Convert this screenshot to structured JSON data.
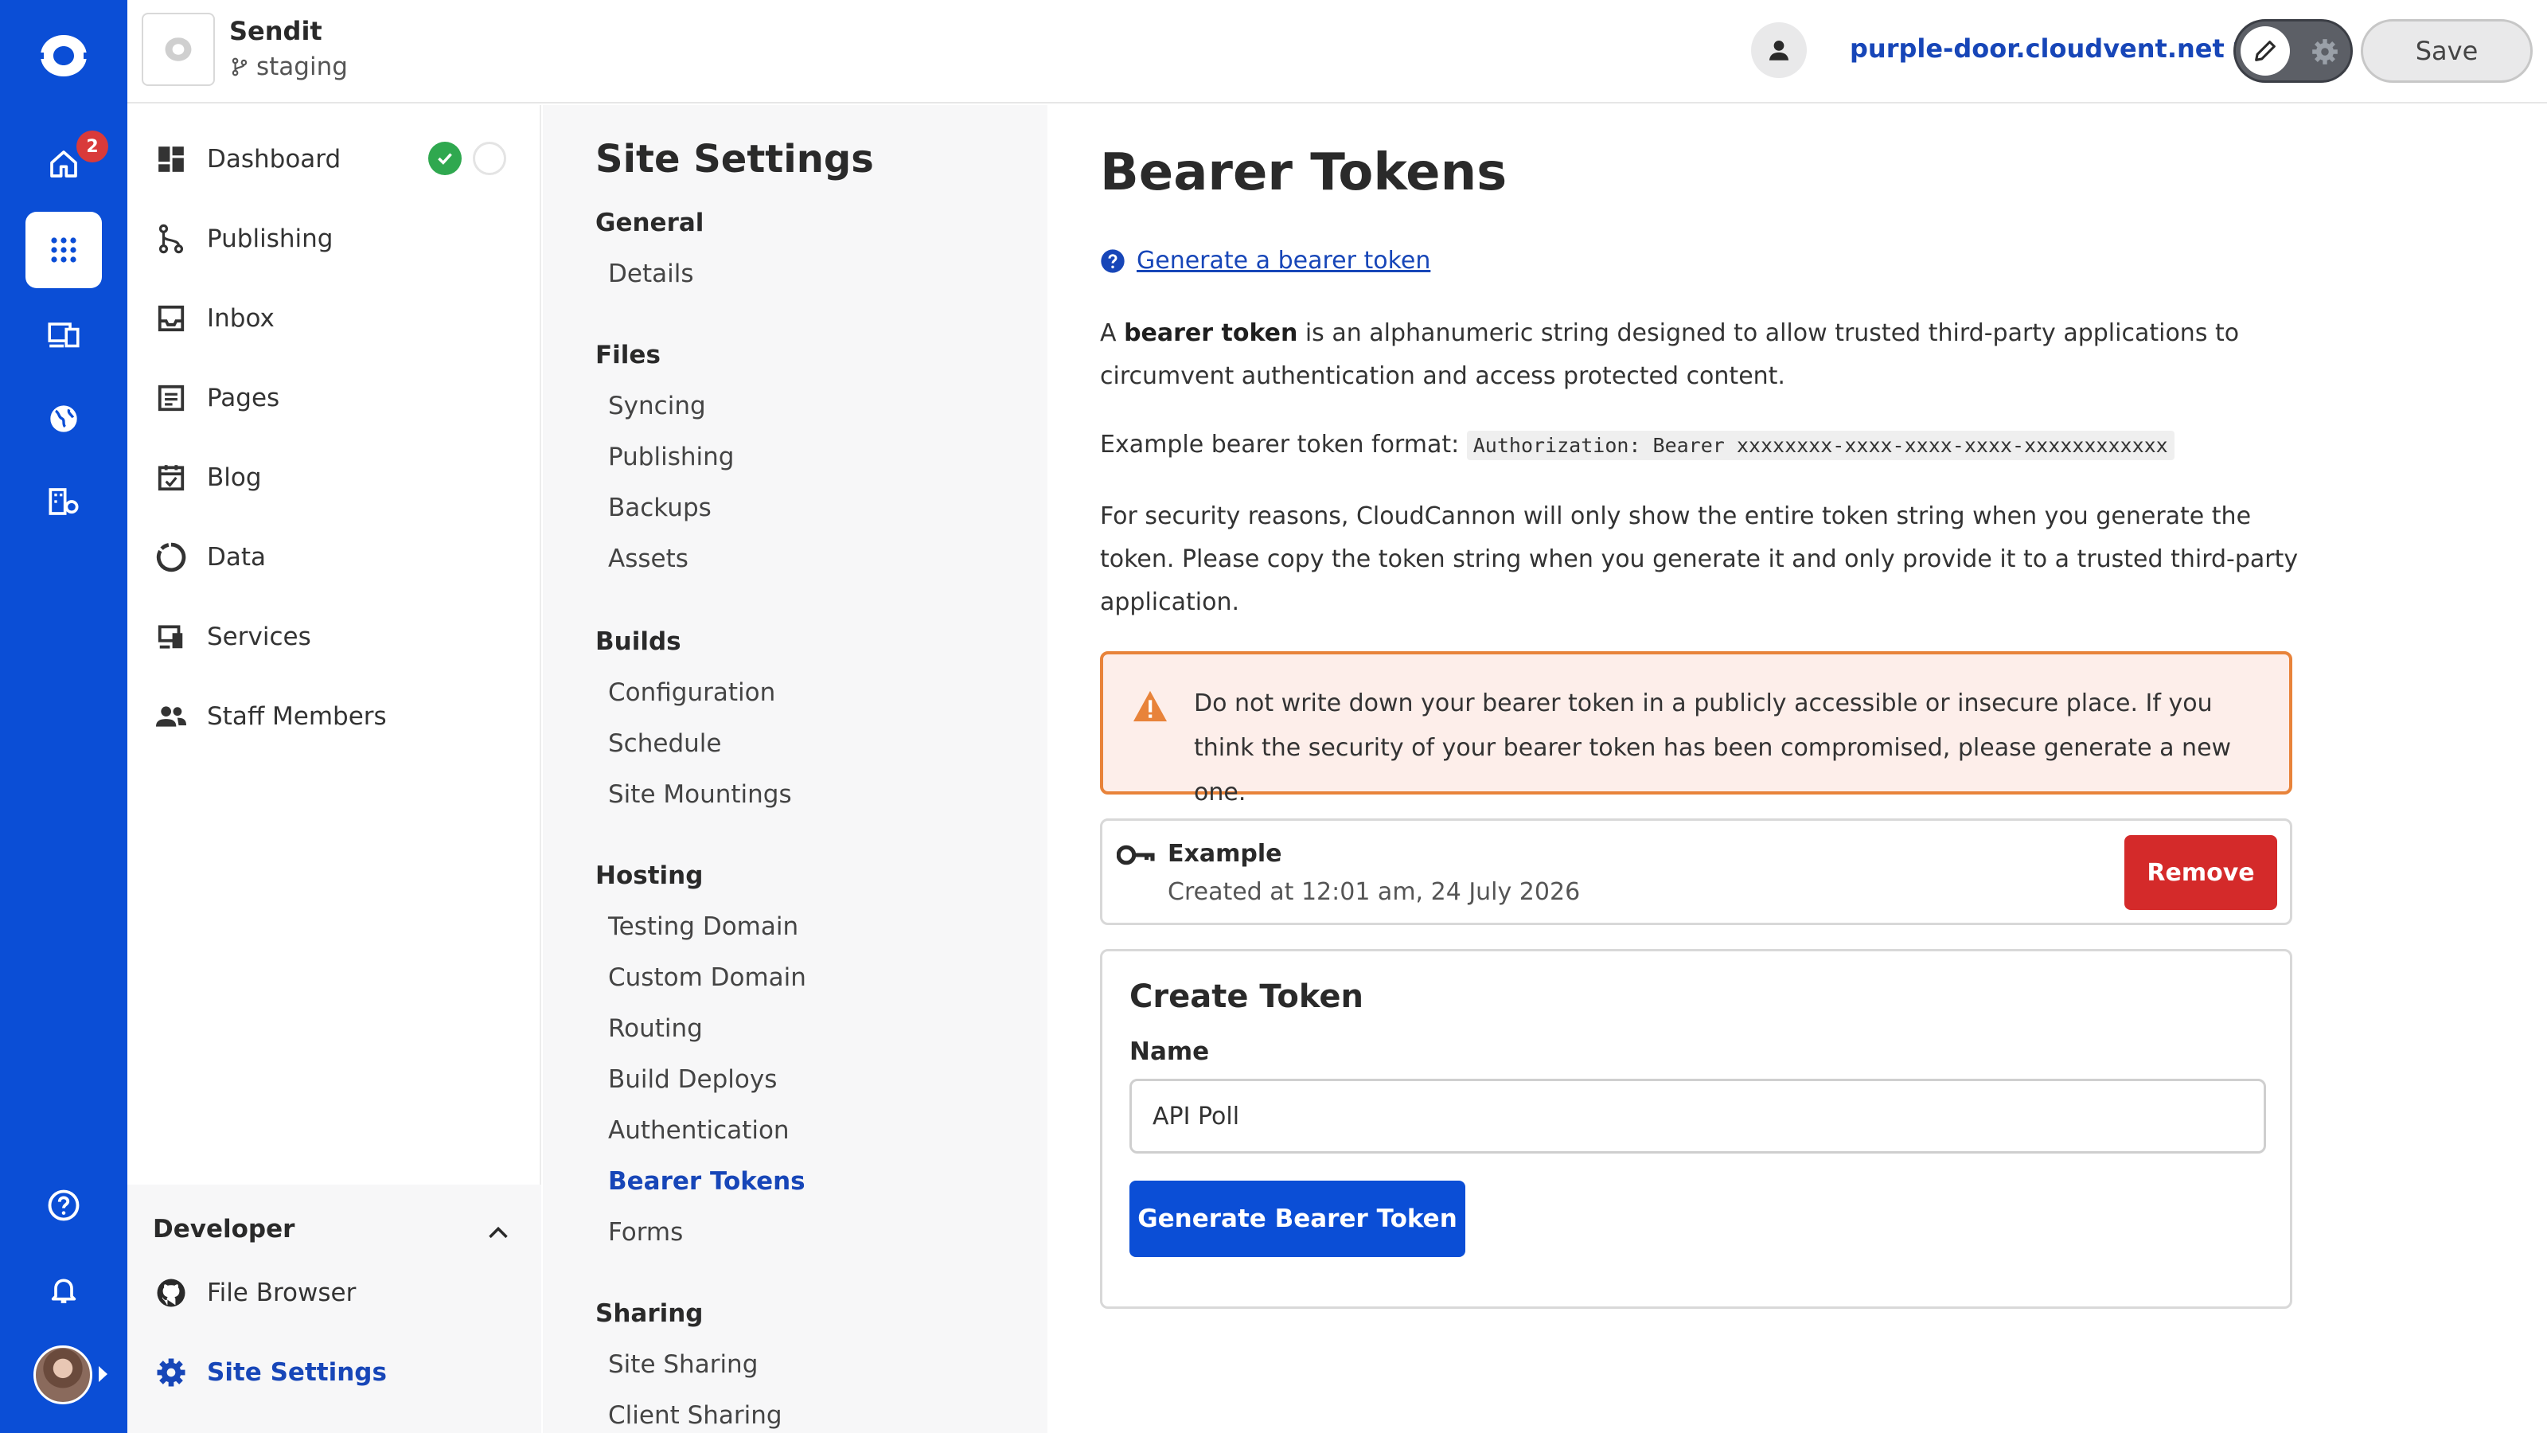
{
  "rail": {
    "notification_count": "2"
  },
  "header": {
    "site_name": "Sendit",
    "branch": "staging",
    "domain": "purple-door.cloudvent.net",
    "save_label": "Save"
  },
  "site_nav": {
    "items": [
      {
        "label": "Dashboard"
      },
      {
        "label": "Publishing"
      },
      {
        "label": "Inbox"
      },
      {
        "label": "Pages"
      },
      {
        "label": "Blog"
      },
      {
        "label": "Data"
      },
      {
        "label": "Services"
      },
      {
        "label": "Staff Members"
      }
    ],
    "developer": {
      "heading": "Developer",
      "items": [
        {
          "label": "File Browser"
        },
        {
          "label": "Site Settings"
        }
      ]
    }
  },
  "settings_menu": {
    "title": "Site Settings",
    "groups": [
      {
        "label": "General",
        "links": [
          "Details"
        ]
      },
      {
        "label": "Files",
        "links": [
          "Syncing",
          "Publishing",
          "Backups",
          "Assets"
        ]
      },
      {
        "label": "Builds",
        "links": [
          "Configuration",
          "Schedule",
          "Site Mountings"
        ]
      },
      {
        "label": "Hosting",
        "links": [
          "Testing Domain",
          "Custom Domain",
          "Routing",
          "Build Deploys",
          "Authentication",
          "Bearer Tokens",
          "Forms"
        ]
      },
      {
        "label": "Sharing",
        "links": [
          "Site Sharing",
          "Client Sharing"
        ]
      }
    ],
    "active": "Bearer Tokens"
  },
  "main": {
    "title": "Bearer Tokens",
    "help_link": "Generate a bearer token",
    "intro_prefix": "A ",
    "intro_bold": "bearer token",
    "intro_rest": " is an alphanumeric string designed to allow trusted third-party applications to circumvent authentication and access protected content.",
    "format_label": "Example bearer token format:",
    "format_code": "Authorization: Bearer xxxxxxxx-xxxx-xxxx-xxxx-xxxxxxxxxxxx",
    "security_note": "For security reasons, CloudCannon will only show the entire token string when you generate the token. Please copy the token string when you generate it and only provide it to a trusted third-party application.",
    "warning": "Do not write down your bearer token in a publicly accessible or insecure place. If you think the security of your bearer token has been compromised, please generate a new one.",
    "token": {
      "name": "Example",
      "created": "Created at 12:01 am, 24 July 2026",
      "remove_label": "Remove"
    },
    "create": {
      "title": "Create Token",
      "name_label": "Name",
      "name_value": "API Poll",
      "button_label": "Generate Bearer Token"
    }
  },
  "colors": {
    "brand_blue": "#0b4ed6",
    "link_blue": "#1746b8",
    "danger_red": "#d42a2a",
    "warning_orange": "#e8833a",
    "success_green": "#2fa84f"
  }
}
